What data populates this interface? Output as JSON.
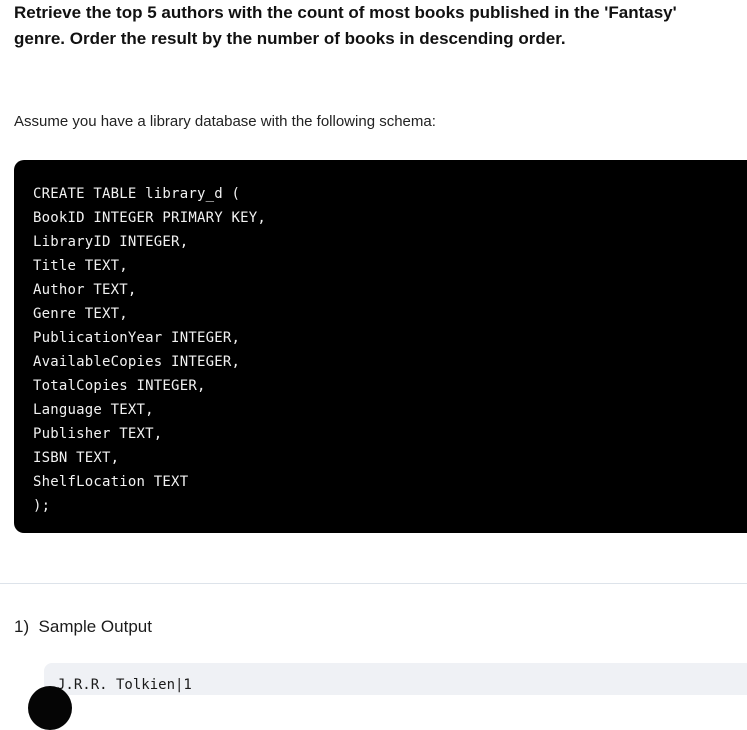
{
  "prompt": {
    "heading": "Retrieve the top 5 authors with the count of most books published in the 'Fantasy' genre. Order the result by the number of books in descending order.",
    "schema_intro": "Assume you have a library database with the following schema:"
  },
  "schema_code": {
    "language": "sql",
    "text": "CREATE TABLE library_d (\nBookID INTEGER PRIMARY KEY,\nLibraryID INTEGER,\nTitle TEXT,\nAuthor TEXT,\nGenre TEXT,\nPublicationYear INTEGER,\nAvailableCopies INTEGER,\nTotalCopies INTEGER,\nLanguage TEXT,\nPublisher TEXT,\nISBN TEXT,\nShelfLocation TEXT\n);",
    "lines": [
      "CREATE TABLE library_d (",
      "BookID INTEGER PRIMARY KEY,",
      "LibraryID INTEGER,",
      "Title TEXT,",
      "Author TEXT,",
      "Genre TEXT,",
      "PublicationYear INTEGER,",
      "AvailableCopies INTEGER,",
      "TotalCopies INTEGER,",
      "Language TEXT,",
      "Publisher TEXT,",
      "ISBN TEXT,",
      "ShelfLocation TEXT",
      ");"
    ],
    "background_color": "#000000",
    "text_color": "#f2f2f2"
  },
  "sample_output_section": {
    "list_marker": "1)",
    "title": "Sample Output",
    "heading_full": "1)  Sample Output",
    "output_text": "J.R.R. Tolkien|1",
    "output_background_color": "#eff1f5"
  },
  "divider": {
    "color": "#dde3ea"
  },
  "avatar": {
    "color": "#050505"
  }
}
